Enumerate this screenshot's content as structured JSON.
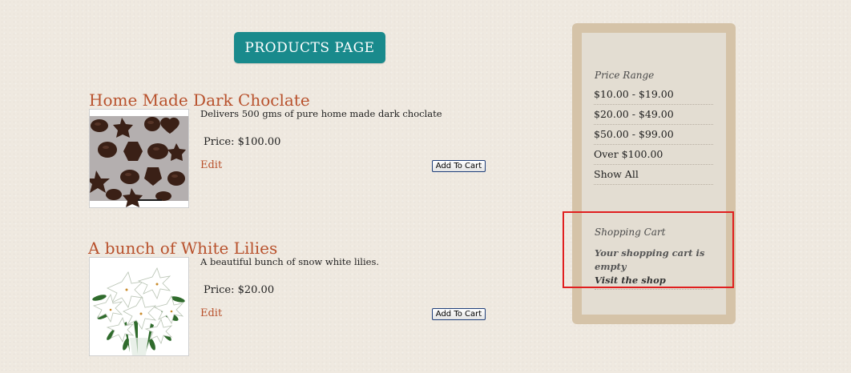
{
  "page": {
    "title": "PRODUCTS PAGE"
  },
  "products": [
    {
      "name": "Home Made Dark Choclate",
      "description": "Delivers 500 gms of pure home made dark choclate",
      "price": "Price: $100.00",
      "edit_label": "Edit",
      "add_to_cart_label": "Add To Cart",
      "image_icon": "chocolate-photo"
    },
    {
      "name": "A bunch of White Lilies",
      "description": "A beautiful bunch of snow white lilies.",
      "price": "Price: $20.00",
      "edit_label": "Edit",
      "add_to_cart_label": "Add To Cart",
      "image_icon": "lilies-photo"
    }
  ],
  "sidebar": {
    "price_range": {
      "title": "Price Range",
      "items": [
        "$10.00 - $19.00",
        "$20.00 - $49.00",
        "$50.00 - $99.00",
        "Over $100.00",
        "Show All"
      ]
    },
    "cart": {
      "title": "Shopping Cart",
      "empty_message": "Your shopping cart is empty",
      "visit_label": "Visit the shop"
    }
  },
  "colors": {
    "accent": "#198a8c",
    "product_title": "#b8512c",
    "sidebar_frame": "#d5c3a8",
    "highlight": "#e01f1f"
  }
}
